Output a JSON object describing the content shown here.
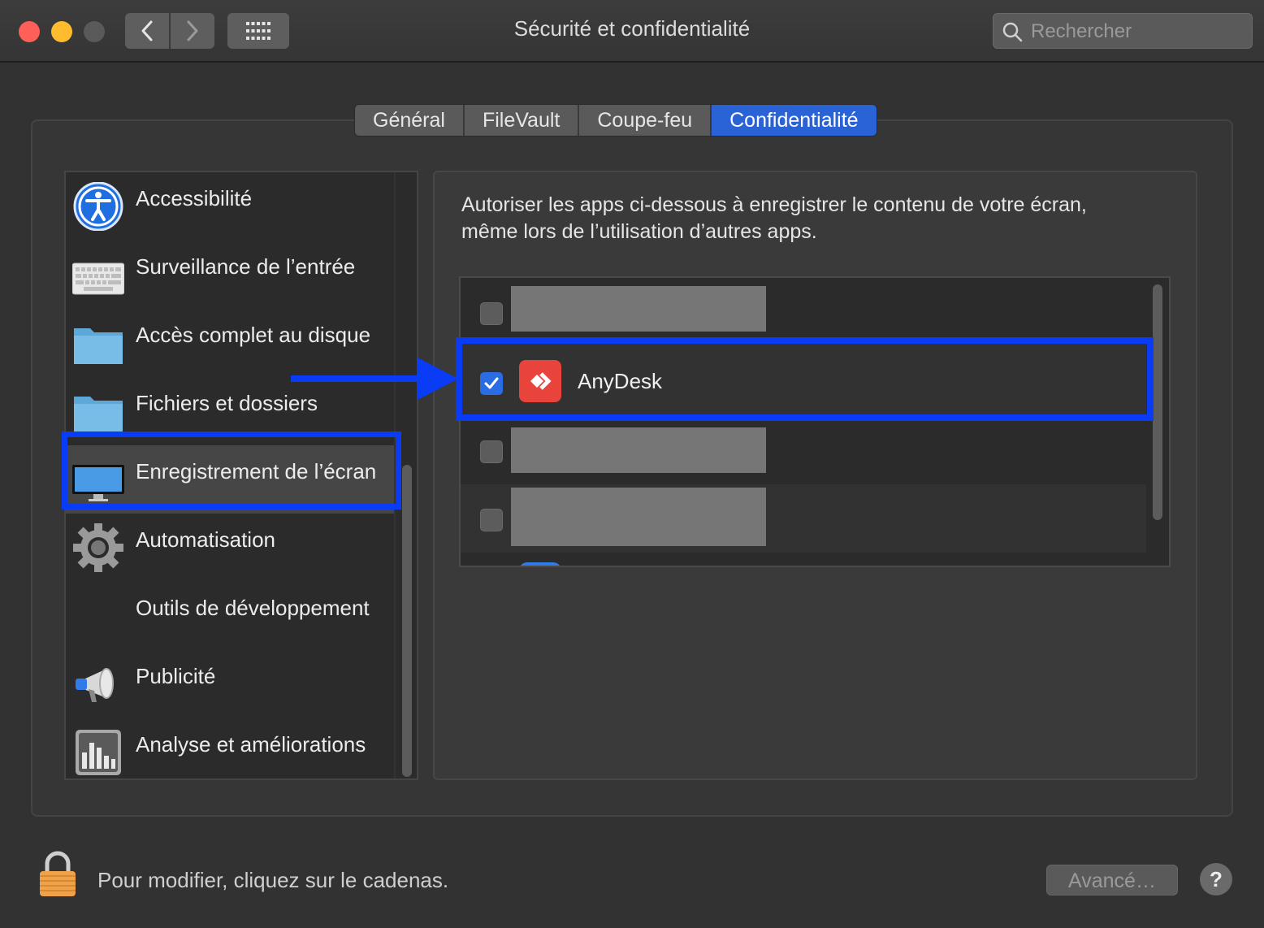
{
  "window": {
    "title": "Sécurité et confidentialité",
    "search_placeholder": "Rechercher"
  },
  "tabs": [
    {
      "label": "Général",
      "active": false
    },
    {
      "label": "FileVault",
      "active": false
    },
    {
      "label": "Coupe-feu",
      "active": false
    },
    {
      "label": "Confidentialité",
      "active": true
    }
  ],
  "sidebar": {
    "items": [
      {
        "label": "Accessibilité",
        "icon": "accessibility-icon"
      },
      {
        "label": "Surveillance de l’entrée",
        "icon": "keyboard-icon"
      },
      {
        "label": "Accès complet au disque",
        "icon": "folder-icon"
      },
      {
        "label": "Fichiers et dossiers",
        "icon": "folder-icon"
      },
      {
        "label": "Enregistrement de l’écran",
        "icon": "display-icon",
        "selected": true
      },
      {
        "label": "Automatisation",
        "icon": "gear-icon"
      },
      {
        "label": "Outils de développement",
        "icon": "none"
      },
      {
        "label": "Publicité",
        "icon": "megaphone-icon"
      },
      {
        "label": "Analyse et améliorations",
        "icon": "chart-icon"
      }
    ]
  },
  "content": {
    "description_line1": "Autoriser les apps ci-dessous à enregistrer le contenu de votre écran,",
    "description_line2": "même lors de l’utilisation d’autres apps.",
    "apps": [
      {
        "name": "",
        "checked": false,
        "redacted": true
      },
      {
        "name": "AnyDesk",
        "checked": true,
        "redacted": false
      },
      {
        "name": "",
        "checked": false,
        "redacted": true
      },
      {
        "name": "",
        "checked": false,
        "redacted": true
      }
    ]
  },
  "footer": {
    "lock_text": "Pour modifier, cliquez sur le cadenas.",
    "advanced_label": "Avancé…",
    "help_label": "?"
  },
  "colors": {
    "accent": "#2a63d6",
    "highlight": "#0a3cf5",
    "anydesk": "#e8443c"
  }
}
